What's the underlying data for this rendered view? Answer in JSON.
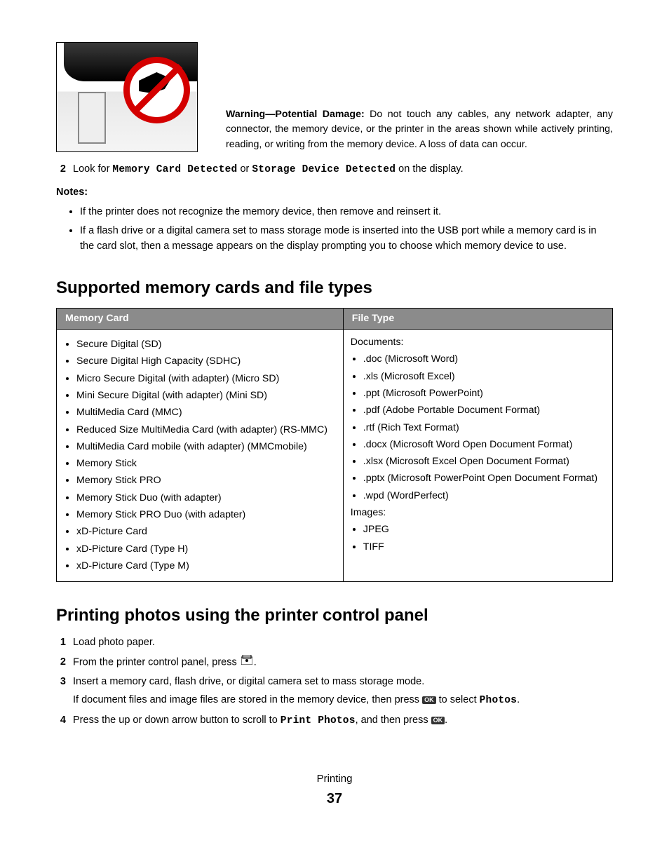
{
  "warning": {
    "label": "Warning—Potential Damage:",
    "text": " Do not touch any cables, any network adapter, any connector, the memory device, or the printer in the areas shown while actively printing, reading, or writing from the memory device. A loss of data can occur."
  },
  "step2": {
    "num": "2",
    "pre": "Look for ",
    "code1": "Memory Card Detected",
    "mid": " or ",
    "code2": "Storage Device Detected",
    "post": " on the display."
  },
  "notesLabel": "Notes:",
  "notes": [
    "If the printer does not recognize the memory device, then remove and reinsert it.",
    "If a flash drive or a digital camera set to mass storage mode is inserted into the USB port while a memory card is in the card slot, then a message appears on the display prompting you to choose which memory device to use."
  ],
  "section1": "Supported memory cards and file types",
  "table": {
    "h1": "Memory Card",
    "h2": "File Type",
    "memoryCards": [
      "Secure Digital (SD)",
      "Secure Digital High Capacity (SDHC)",
      "Micro Secure Digital (with adapter) (Micro SD)",
      "Mini Secure Digital (with adapter) (Mini SD)",
      "MultiMedia Card (MMC)",
      "Reduced Size MultiMedia Card (with adapter) (RS-MMC)",
      "MultiMedia Card mobile (with adapter) (MMCmobile)",
      "Memory Stick",
      "Memory Stick PRO",
      "Memory Stick Duo (with adapter)",
      "Memory Stick PRO Duo (with adapter)",
      "xD-Picture Card",
      "xD-Picture Card (Type H)",
      "xD-Picture Card (Type M)"
    ],
    "docLabel": "Documents:",
    "documents": [
      ".doc (Microsoft Word)",
      ".xls (Microsoft Excel)",
      ".ppt (Microsoft PowerPoint)",
      ".pdf (Adobe Portable Document Format)",
      ".rtf (Rich Text Format)",
      ".docx (Microsoft Word Open Document Format)",
      ".xlsx (Microsoft Excel Open Document Format)",
      ".pptx (Microsoft PowerPoint Open Document Format)",
      ".wpd (WordPerfect)"
    ],
    "imgLabel": "Images:",
    "images": [
      "JPEG",
      "TIFF"
    ]
  },
  "section2": "Printing photos using the printer control panel",
  "printSteps": {
    "s1": {
      "num": "1",
      "text": "Load photo paper."
    },
    "s2": {
      "num": "2",
      "pre": "From the printer control panel, press ",
      "post": "."
    },
    "s3": {
      "num": "3",
      "line1": "Insert a memory card, flash drive, or digital camera set to mass storage mode.",
      "line2a": "If document files and image files are stored in the memory device, then press ",
      "line2b": " to select ",
      "code": "Photos",
      "line2c": "."
    },
    "s4": {
      "num": "4",
      "pre": "Press the up or down arrow button to scroll to ",
      "code": "Print Photos",
      "mid": ", and then press ",
      "post": "."
    }
  },
  "footer": {
    "chapter": "Printing",
    "page": "37"
  },
  "ok": "OK"
}
